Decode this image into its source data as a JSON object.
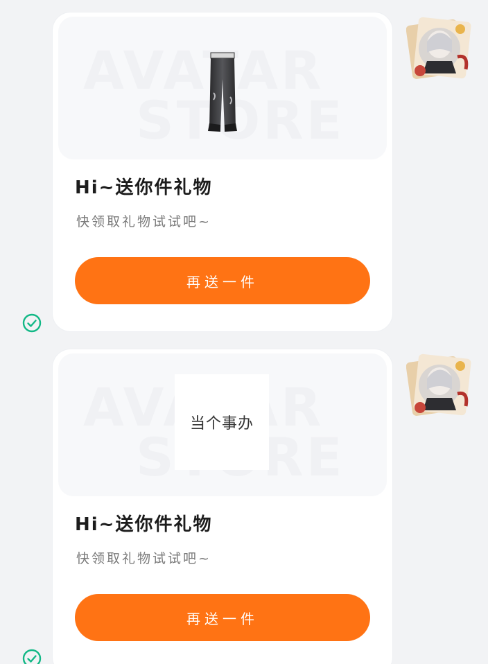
{
  "chat": {
    "messages": [
      {
        "preview": {
          "watermark_line1": "AVATAR",
          "watermark_line2": "STORE",
          "item_icon": "jeans-icon",
          "item_label": ""
        },
        "title": "Hi~送你件礼物",
        "subtitle": "快领取礼物试试吧~",
        "button_label": "再送一件",
        "status_icon": "check-circle-icon"
      },
      {
        "preview": {
          "watermark_line1": "AVATAR",
          "watermark_line2": "STORE",
          "item_icon": "",
          "item_label": "当个事办"
        },
        "title": "Hi~送你件礼物",
        "subtitle": "快领取礼物试试吧~",
        "button_label": "再送一件",
        "status_icon": "check-circle-icon"
      }
    ]
  },
  "colors": {
    "background": "#f2f3f5",
    "card": "#ffffff",
    "button": "#ff7314",
    "button_text": "#ffffff",
    "check": "#12b886",
    "title": "#1c1c1c",
    "subtitle": "#7a7a7a"
  }
}
